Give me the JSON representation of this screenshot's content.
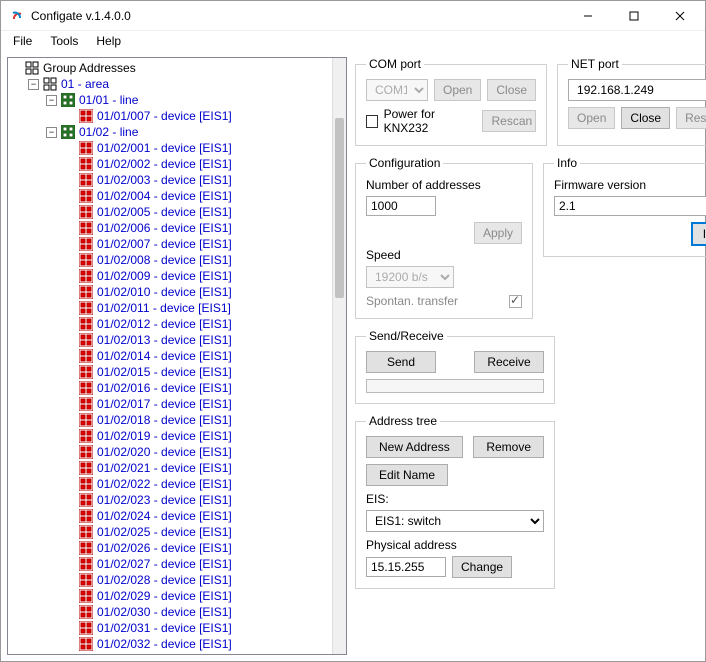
{
  "window": {
    "title": "Configate v.1.4.0.0"
  },
  "menu": {
    "file": "File",
    "tools": "Tools",
    "help": "Help"
  },
  "tree": {
    "root": "Group Addresses",
    "area": "01 - area",
    "line1": "01/01 - line",
    "line1_dev": "01/01/007 - device [EIS1]",
    "line2": "01/02 - line",
    "devices": [
      "01/02/001 - device [EIS1]",
      "01/02/002 - device [EIS1]",
      "01/02/003 - device [EIS1]",
      "01/02/004 - device [EIS1]",
      "01/02/005 - device [EIS1]",
      "01/02/006 - device [EIS1]",
      "01/02/007 - device [EIS1]",
      "01/02/008 - device [EIS1]",
      "01/02/009 - device [EIS1]",
      "01/02/010 - device [EIS1]",
      "01/02/011 - device [EIS1]",
      "01/02/012 - device [EIS1]",
      "01/02/013 - device [EIS1]",
      "01/02/014 - device [EIS1]",
      "01/02/015 - device [EIS1]",
      "01/02/016 - device [EIS1]",
      "01/02/017 - device [EIS1]",
      "01/02/018 - device [EIS1]",
      "01/02/019 - device [EIS1]",
      "01/02/020 - device [EIS1]",
      "01/02/021 - device [EIS1]",
      "01/02/022 - device [EIS1]",
      "01/02/023 - device [EIS1]",
      "01/02/024 - device [EIS1]",
      "01/02/025 - device [EIS1]",
      "01/02/026 - device [EIS1]",
      "01/02/027 - device [EIS1]",
      "01/02/028 - device [EIS1]",
      "01/02/029 - device [EIS1]",
      "01/02/030 - device [EIS1]",
      "01/02/031 - device [EIS1]",
      "01/02/032 - device [EIS1]"
    ]
  },
  "com": {
    "legend": "COM port",
    "port": "COM1",
    "open": "Open",
    "close": "Close",
    "power_label": "Power for KNX232",
    "rescan": "Rescan"
  },
  "net": {
    "legend": "NET port",
    "ip": "192.168.1.249",
    "open": "Open",
    "close": "Close",
    "rescan": "Rescan"
  },
  "config": {
    "legend": "Configuration",
    "num_label": "Number of addresses",
    "num_value": "1000",
    "apply": "Apply",
    "speed_label": "Speed",
    "speed_value": "19200 b/s",
    "spontan_label": "Spontan. transfer"
  },
  "info": {
    "legend": "Info",
    "fw_label": "Firmware version",
    "fw_value": "2.1",
    "info_btn": "Info"
  },
  "sendrecv": {
    "legend": "Send/Receive",
    "send": "Send",
    "receive": "Receive"
  },
  "addr": {
    "legend": "Address tree",
    "new": "New Address",
    "remove": "Remove",
    "edit": "Edit Name",
    "eis_label": "EIS:",
    "eis_value": "EIS1: switch",
    "phys_label": "Physical address",
    "phys_value": "15.15.255",
    "change": "Change"
  }
}
